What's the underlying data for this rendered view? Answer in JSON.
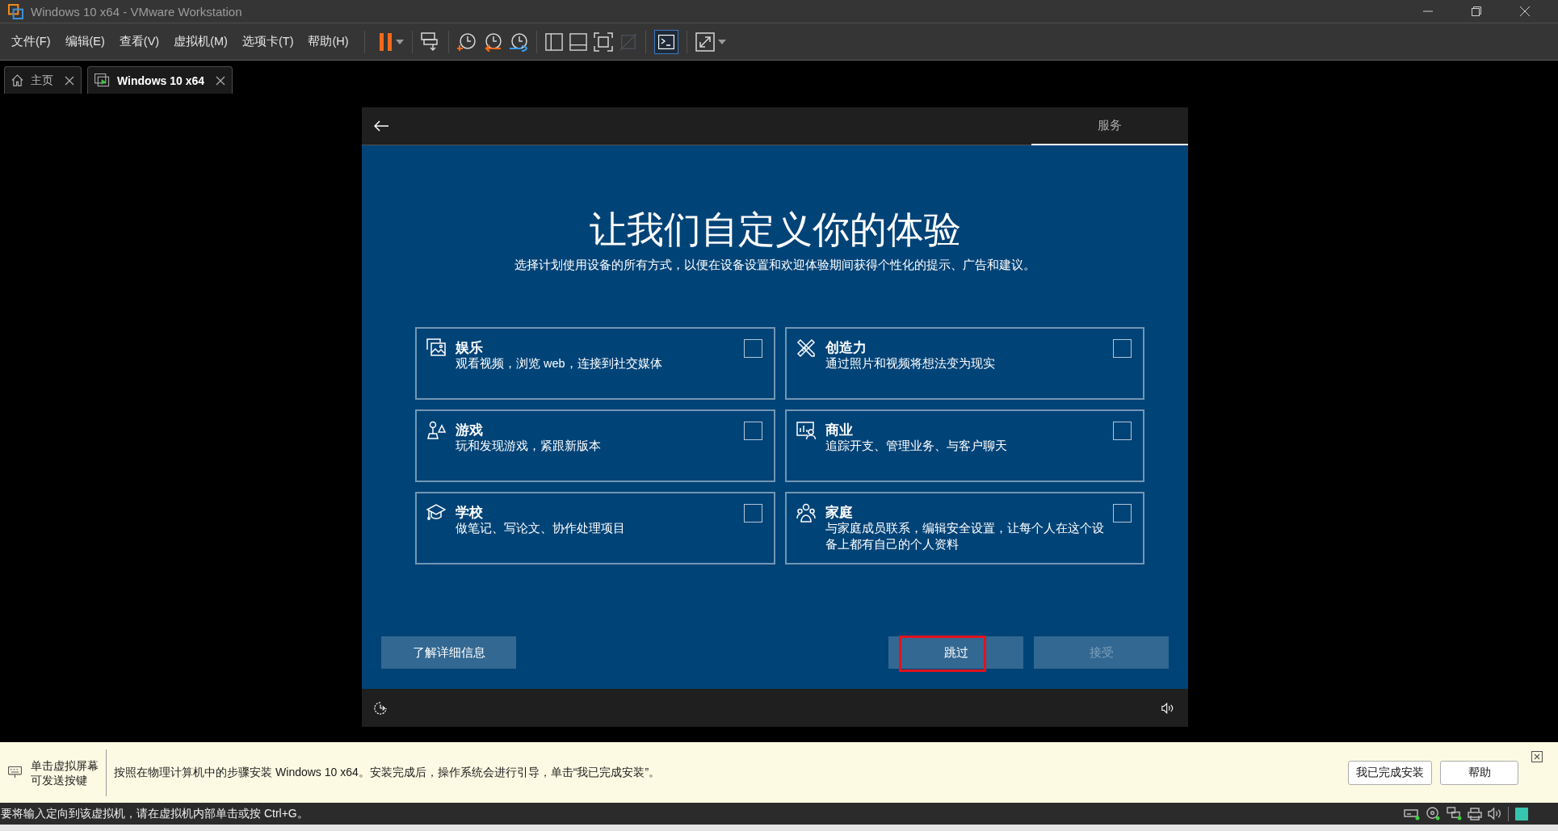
{
  "window": {
    "title": "Windows 10 x64 - VMware Workstation"
  },
  "menu": [
    "文件(F)",
    "编辑(E)",
    "查看(V)",
    "虚拟机(M)",
    "选项卡(T)",
    "帮助(H)"
  ],
  "tabs": [
    {
      "label": "主页",
      "selected": false
    },
    {
      "label": "Windows 10 x64",
      "selected": true
    }
  ],
  "setup": {
    "steps": [
      {
        "label": "服务",
        "selected": true
      }
    ],
    "title": "让我们自定义你的体验",
    "subtitle": "选择计划使用设备的所有方式，以便在设备设置和欢迎体验期间获得个性化的提示、广告和建议。",
    "options": [
      {
        "title": "娱乐",
        "description": "观看视频，浏览 web，连接到社交媒体",
        "checked": false
      },
      {
        "title": "创造力",
        "description": "通过照片和视频将想法变为现实",
        "checked": false
      },
      {
        "title": "游戏",
        "description": "玩和发现游戏，紧跟新版本",
        "checked": false
      },
      {
        "title": "商业",
        "description": "追踪开支、管理业务、与客户聊天",
        "checked": false
      },
      {
        "title": "学校",
        "description": "做笔记、写论文、协作处理项目",
        "checked": false
      },
      {
        "title": "家庭",
        "description": "与家庭成员联系，编辑安全设置，让每个人在这个设备上都有自己的个人资料",
        "checked": false
      }
    ],
    "buttons": [
      {
        "label": "了解详细信息",
        "disabled": false,
        "highlighted": false
      },
      {
        "label": "跳过",
        "disabled": false,
        "highlighted": true
      },
      {
        "label": "接受",
        "disabled": true,
        "highlighted": false
      }
    ]
  },
  "hint_bar": {
    "label": "单击虚拟屏幕可发送按键",
    "message": "按照在物理计算机中的步骤安装 Windows 10 x64。安装完成后，操作系统会进行引导，单击“我已完成安装”。",
    "buttons": [
      "我已完成安装",
      "帮助"
    ]
  },
  "status_bar": {
    "text": "要将输入定向到该虚拟机，请在虚拟机内部单击或按 Ctrl+G。"
  }
}
